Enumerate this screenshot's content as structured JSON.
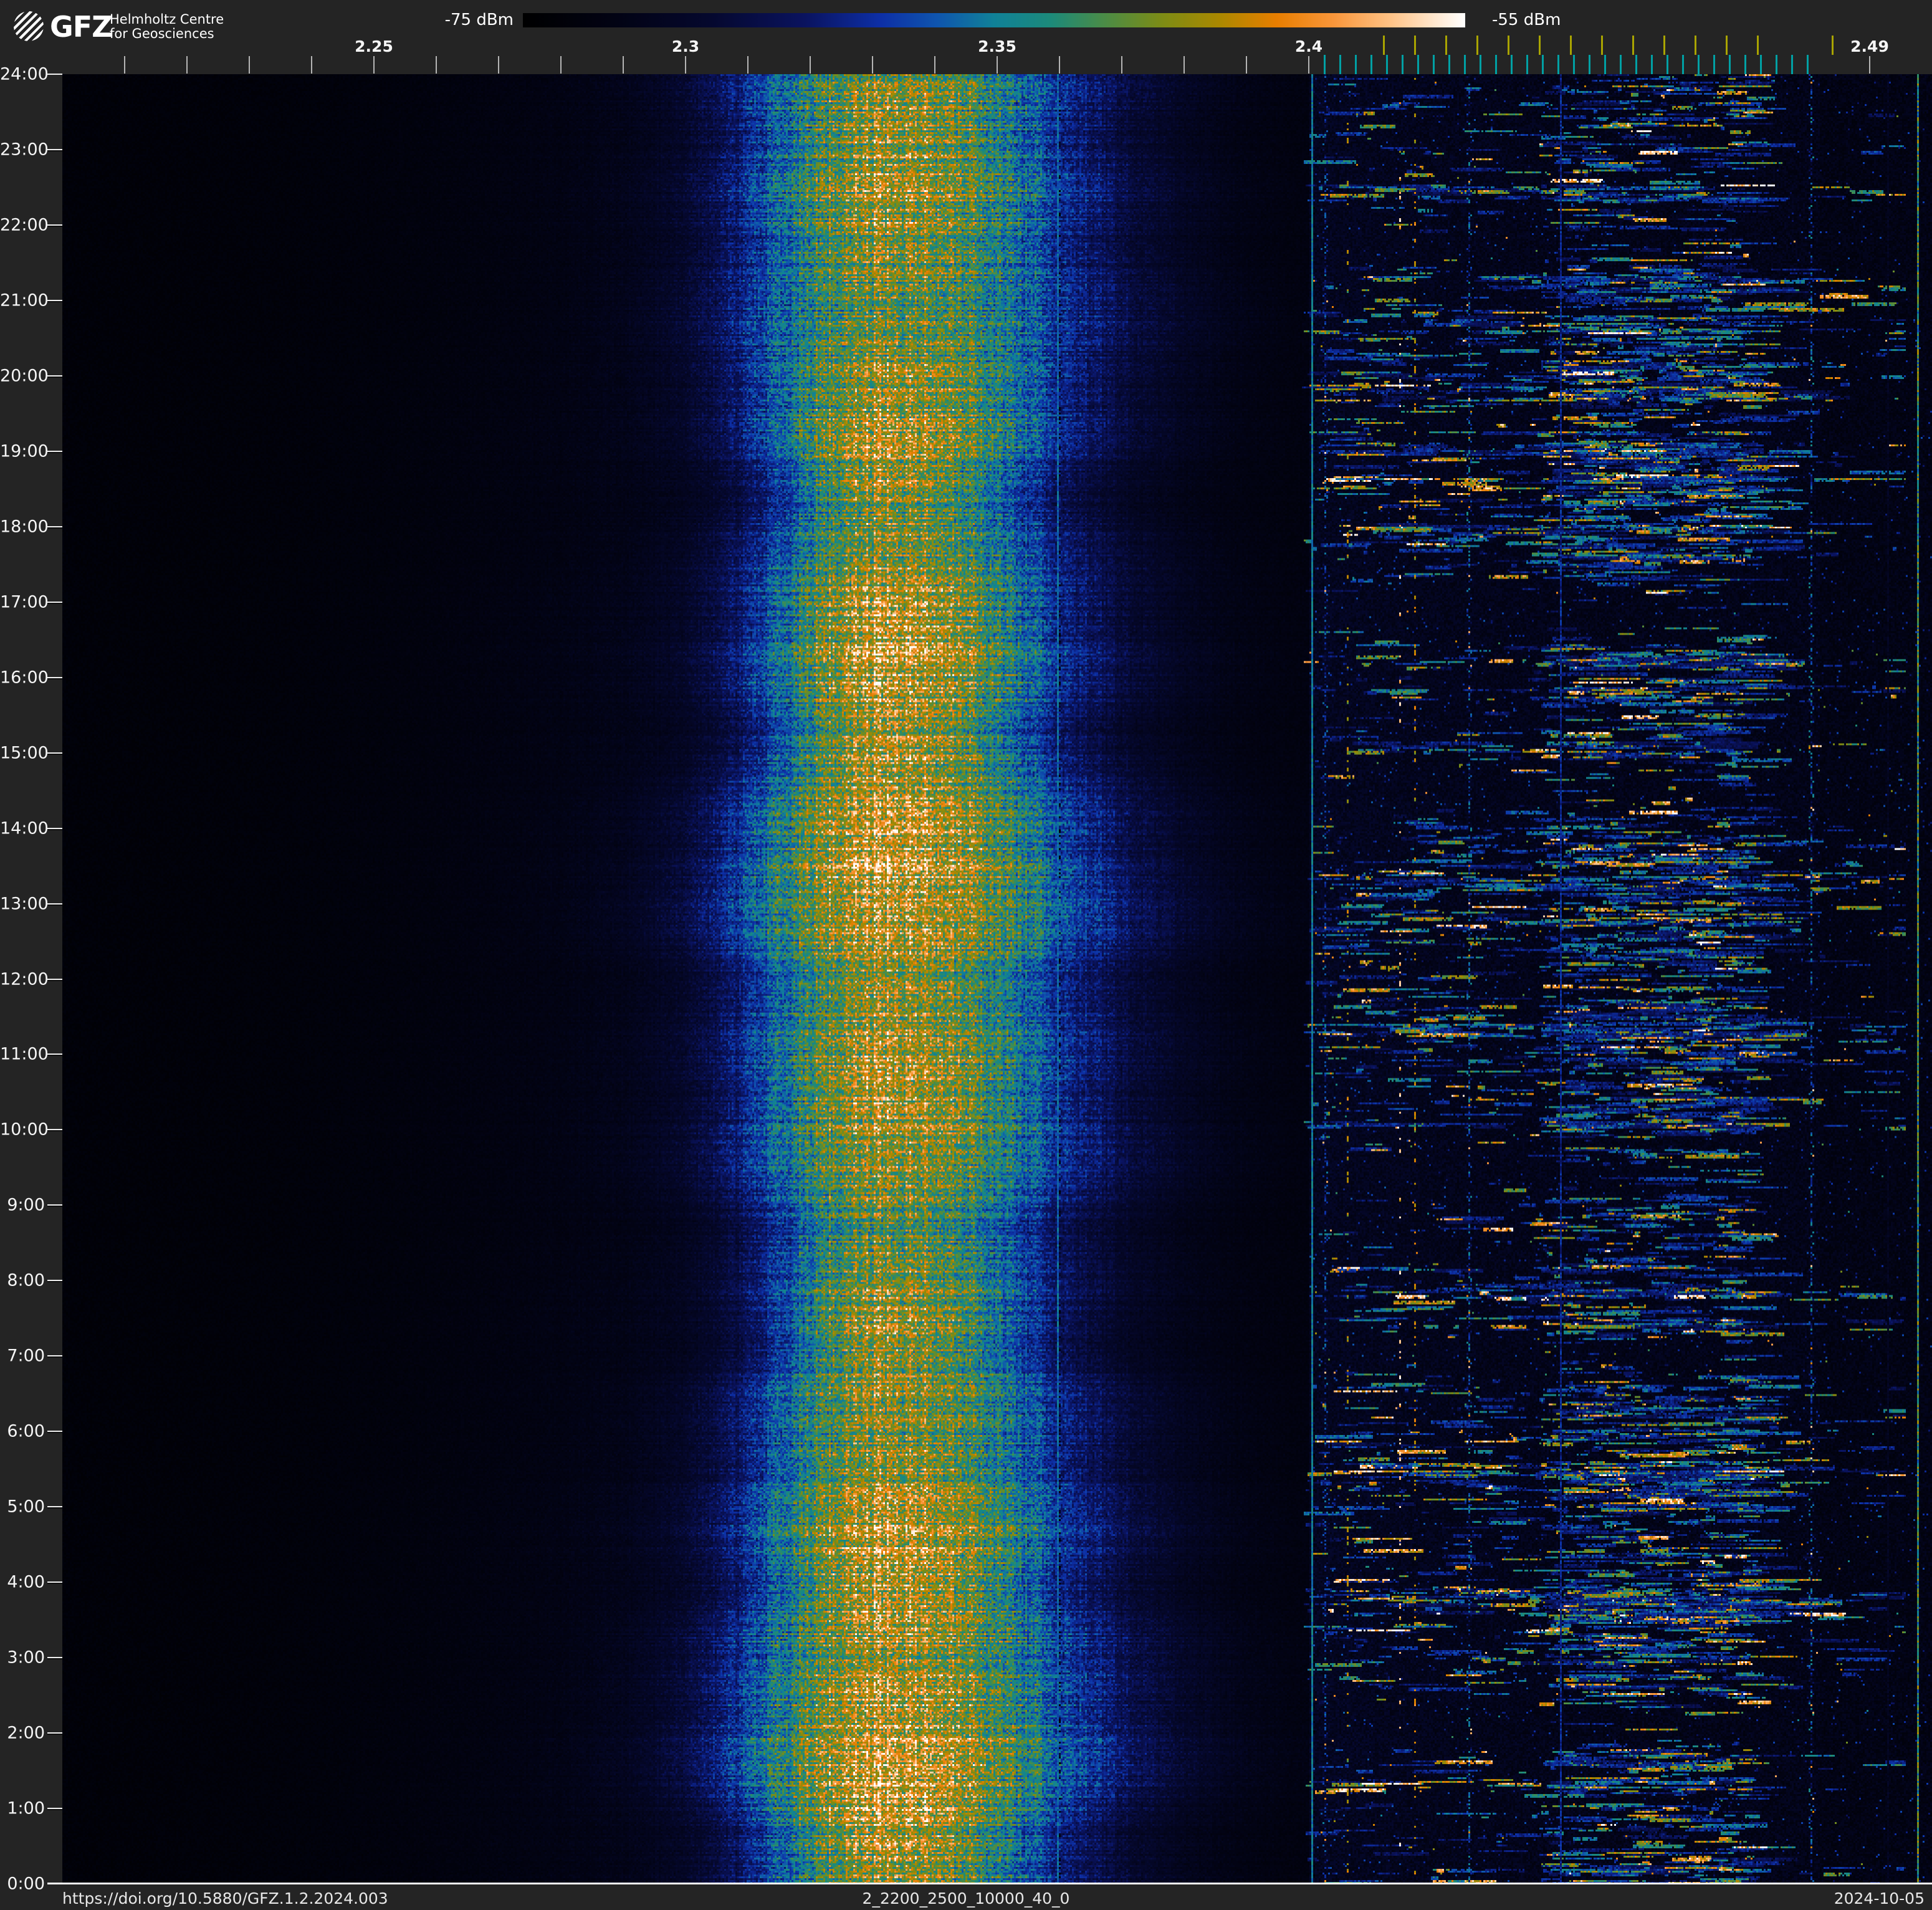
{
  "header": {
    "logo": {
      "acronym": "GFZ",
      "line1": "Helmholtz Centre",
      "line2": "for Geosciences"
    },
    "colorbar": {
      "min_label": "-75 dBm",
      "max_label": "-55 dBm"
    }
  },
  "footer": {
    "doi": "https://doi.org/10.5880/GFZ.1.2.2024.003",
    "dataset": "2_2200_2500_10000_40_0",
    "date": "2024-10-05"
  },
  "chart_data": {
    "type": "heatmap",
    "subtype": "radio-spectrogram-waterfall",
    "x_axis": {
      "quantity": "frequency",
      "unit": "GHz",
      "min": 2.2,
      "max": 2.5,
      "minor_tick_step": 0.01,
      "tick_labels": [
        {
          "text": "2.25",
          "ghz": 2.25
        },
        {
          "text": "2.3",
          "ghz": 2.3
        },
        {
          "text": "2.35",
          "ghz": 2.35
        },
        {
          "text": "2.4",
          "ghz": 2.4
        },
        {
          "text": "2.49",
          "ghz": 2.49
        }
      ]
    },
    "y_axis": {
      "quantity": "time-of-day",
      "hour_step": 1,
      "top_label": "24:00",
      "bottom_label": "0:00",
      "labels": [
        "24:00",
        "23:00",
        "22:00",
        "21:00",
        "20:00",
        "19:00",
        "18:00",
        "17:00",
        "16:00",
        "15:00",
        "14:00",
        "13:00",
        "12:00",
        "11:00",
        "10:00",
        "9:00",
        "8:00",
        "7:00",
        "6:00",
        "5:00",
        "4:00",
        "3:00",
        "2:00",
        "1:00",
        "0:00"
      ]
    },
    "colorbar": {
      "min_dbm": -75,
      "max_dbm": -55,
      "stops": [
        [
          0.0,
          "#000000"
        ],
        [
          0.1,
          "#020314"
        ],
        [
          0.2,
          "#05082e"
        ],
        [
          0.3,
          "#0a135f"
        ],
        [
          0.38,
          "#0d2fa6"
        ],
        [
          0.44,
          "#0f55ae"
        ],
        [
          0.5,
          "#108198"
        ],
        [
          0.56,
          "#1c8a7a"
        ],
        [
          0.62,
          "#4d8c44"
        ],
        [
          0.68,
          "#7e8c14"
        ],
        [
          0.74,
          "#ab8800"
        ],
        [
          0.8,
          "#e87e00"
        ],
        [
          0.86,
          "#f9963a"
        ],
        [
          0.92,
          "#ffc285"
        ],
        [
          0.97,
          "#ffe9d2"
        ],
        [
          1.0,
          "#ffffff"
        ]
      ]
    },
    "channel_markers": {
      "wifi_channels_ghz": [
        2.412,
        2.417,
        2.422,
        2.427,
        2.432,
        2.437,
        2.442,
        2.447,
        2.452,
        2.457,
        2.462,
        2.467,
        2.472,
        2.484
      ],
      "wifi_tick_color": "#a9a400",
      "narrow_ticks": {
        "start_ghz": 2.4025,
        "end_ghz": 2.48,
        "step_ghz": 0.0025,
        "color": "#00a0a4"
      }
    },
    "grid": {
      "horizontal": "hourly white lines",
      "vertical": "faint line every 0.01 GHz"
    },
    "features": {
      "render_seed": 20241005,
      "noise_floor": {
        "left_v": 0.042,
        "ism_v": 0.115,
        "ism_from_ghz": 2.4,
        "far_right_v": 0.1,
        "far_right_from_ghz": 2.482
      },
      "broadband_band": {
        "center_ghz": 2.3315,
        "sigma_left_ghz": 0.015,
        "sigma_right_ghz": 0.0215,
        "peak_v": 0.58,
        "pedestal_sigma_ghz": 0.045,
        "pedestal_v": 0.1,
        "peak_dbm_approx": -62,
        "persists": "all 24 h with slow width/intensity variation"
      },
      "ism_activity": {
        "zones": [
          {
            "from_ghz": 2.399,
            "to_ghz": 2.437,
            "dashes_per_row": 2.4
          },
          {
            "from_ghz": 2.437,
            "to_ghz": 2.4705,
            "dashes_per_row": 7.0
          },
          {
            "from_ghz": 2.4705,
            "to_ghz": 2.4955,
            "dashes_per_row": 0.9
          }
        ],
        "dash_value_mix": "62% blue, 20% teal, 10% green-olive, 6% orange, 2% white",
        "burst_probability": 0.035,
        "burst_multiplier": 2.6
      },
      "carriers": [
        {
          "ghz": 2.3597,
          "style": "line",
          "v": 0.46,
          "flicker": 0.25
        },
        {
          "ghz": 2.4004,
          "style": "line",
          "v": 0.5,
          "flicker": 0.25
        },
        {
          "ghz": 2.4026,
          "style": "speckle",
          "density": 0.55,
          "vmin": 0.2,
          "vmax": 0.5,
          "bright_p": 0.03
        },
        {
          "ghz": 2.406,
          "style": "dots",
          "density": 0.1,
          "v": 0.74
        },
        {
          "ghz": 2.4145,
          "style": "dots",
          "density": 0.06,
          "v": 0.93
        },
        {
          "ghz": 2.4169,
          "style": "dots",
          "density": 0.15,
          "v": 0.76
        },
        {
          "ghz": 2.4255,
          "style": "speckle",
          "density": 0.6,
          "vmin": 0.22,
          "vmax": 0.55,
          "bright_p": 0.04
        },
        {
          "ghz": 2.4403,
          "style": "line",
          "v": 0.35,
          "flicker": 0.4
        },
        {
          "ghz": 2.4805,
          "style": "speckle",
          "density": 0.65,
          "vmin": 0.2,
          "vmax": 0.55,
          "bright_p": 0.05
        },
        {
          "ghz": 2.4928,
          "style": "faint_line",
          "v": 0.15
        },
        {
          "ghz": 2.4975,
          "style": "faint_line",
          "v": 0.6
        }
      ]
    }
  }
}
